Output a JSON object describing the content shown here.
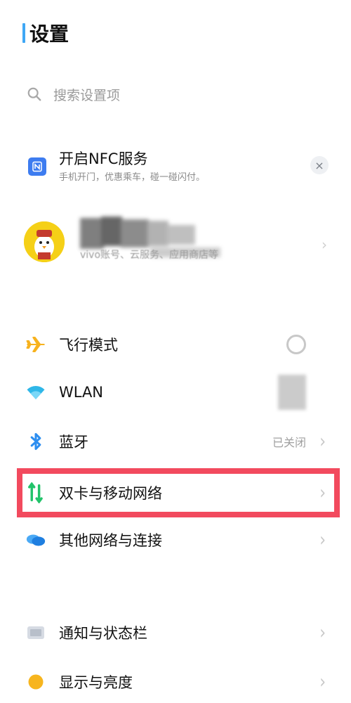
{
  "header": {
    "title": "设置"
  },
  "search": {
    "placeholder": "搜索设置项"
  },
  "nfc_card": {
    "title": "开启NFC服务",
    "subtitle": "手机开门，优惠乘车，碰一碰闪付。",
    "icon": "nfc-icon",
    "close": "×"
  },
  "account": {
    "subtitle": "vivo账号、云服务、应用商店等",
    "icon": "avatar"
  },
  "settings": {
    "airplane": {
      "label": "飞行模式",
      "icon": "airplane-icon",
      "toggle": "off"
    },
    "wlan": {
      "label": "WLAN",
      "icon": "wifi-icon"
    },
    "bluetooth": {
      "label": "蓝牙",
      "value": "已关闭",
      "icon": "bluetooth-icon"
    },
    "mobile": {
      "label": "双卡与移动网络",
      "icon": "dual-sim-icon"
    },
    "other_networks": {
      "label": "其他网络与连接",
      "icon": "link-icon"
    },
    "notifications": {
      "label": "通知与状态栏",
      "icon": "notification-icon"
    },
    "display": {
      "label": "显示与亮度",
      "icon": "brightness-icon"
    }
  },
  "colors": {
    "accent": "#3fa7f5",
    "highlight": "#f24a5e",
    "nfc_blue": "#3d7cf0"
  }
}
